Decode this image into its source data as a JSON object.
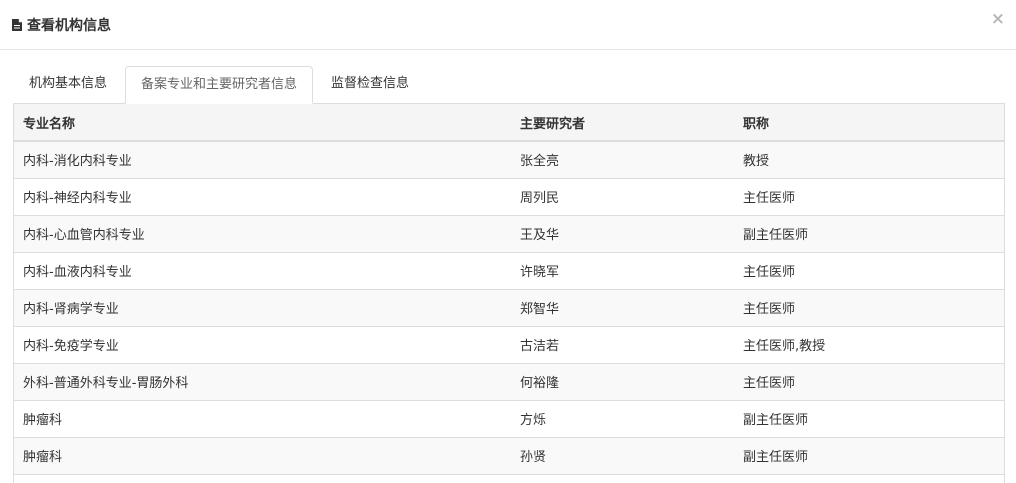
{
  "modal": {
    "title": "查看机构信息",
    "title_icon": "file-icon",
    "close_label": "×"
  },
  "tabs": [
    {
      "label": "机构基本信息",
      "active": false
    },
    {
      "label": "备案专业和主要研究者信息",
      "active": true
    },
    {
      "label": "监督检查信息",
      "active": false
    }
  ],
  "table": {
    "headers": [
      "专业名称",
      "主要研究者",
      "职称"
    ],
    "rows": [
      [
        "内科-消化内科专业",
        "张全亮",
        "教授"
      ],
      [
        "内科-神经内科专业",
        "周列民",
        "主任医师"
      ],
      [
        "内科-心血管内科专业",
        "王及华",
        "副主任医师"
      ],
      [
        "内科-血液内科专业",
        "许晓军",
        "主任医师"
      ],
      [
        "内科-肾病学专业",
        "郑智华",
        "主任医师"
      ],
      [
        "内科-免疫学专业",
        "古洁若",
        "主任医师,教授"
      ],
      [
        "外科-普通外科专业-胃肠外科",
        "何裕隆",
        "主任医师"
      ],
      [
        "肿瘤科",
        "方烁",
        "副主任医师"
      ],
      [
        "肿瘤科",
        "孙贤",
        "副主任医师"
      ]
    ]
  }
}
